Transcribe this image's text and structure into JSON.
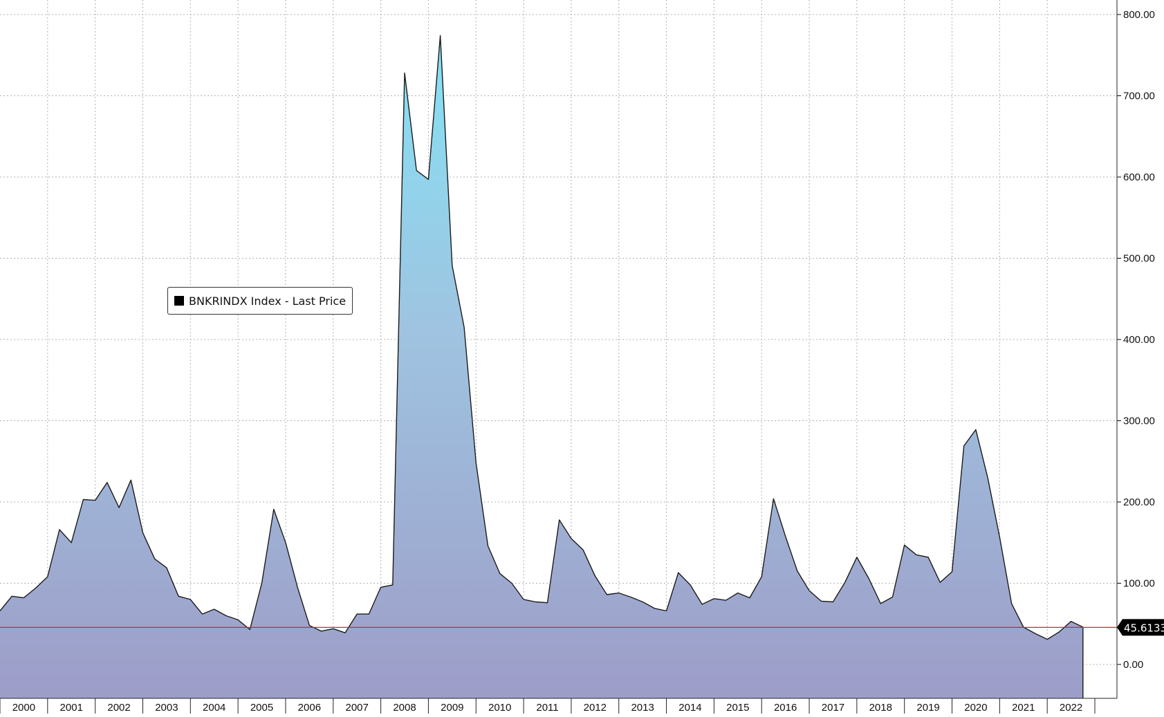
{
  "legend": {
    "label": "BNKRINDX Index - Last Price",
    "swatch_color": "#000000"
  },
  "last_value": {
    "label": "45.6133",
    "value": 45.6133,
    "line_color": "#e02020"
  },
  "colors": {
    "fill_top": "#84e3f5",
    "fill_bottom": "#9d9dc8",
    "line": "#1a1a1a",
    "grid": "#b0b0b0"
  },
  "chart_data": {
    "type": "area",
    "title": "",
    "xlabel": "",
    "ylabel": "",
    "ylim": [
      -40,
      800
    ],
    "xlim": [
      2000.0,
      2023.0
    ],
    "grid": true,
    "legend_position": "middle-left",
    "y_axis_side": "right",
    "y_ticks": [
      0,
      100,
      200,
      300,
      400,
      500,
      600,
      700,
      800
    ],
    "y_tick_labels": [
      "0.00",
      "100.00",
      "200.00",
      "300.00",
      "400.00",
      "500.00",
      "600.00",
      "700.00",
      "800.00"
    ],
    "x_tick_labels": [
      "2000",
      "2001",
      "2002",
      "2003",
      "2004",
      "2005",
      "2006",
      "2007",
      "2008",
      "2009",
      "2010",
      "2011",
      "2012",
      "2013",
      "2014",
      "2015",
      "2016",
      "2017",
      "2018",
      "2019",
      "2020",
      "2021",
      "2022"
    ],
    "series": [
      {
        "name": "BNKRINDX Index - Last Price",
        "x": [
          2000.0,
          2000.25,
          2000.5,
          2000.75,
          2001.0,
          2001.25,
          2001.5,
          2001.75,
          2002.0,
          2002.25,
          2002.5,
          2002.75,
          2003.0,
          2003.25,
          2003.5,
          2003.75,
          2004.0,
          2004.25,
          2004.5,
          2004.75,
          2005.0,
          2005.25,
          2005.5,
          2005.75,
          2006.0,
          2006.25,
          2006.5,
          2006.75,
          2007.0,
          2007.25,
          2007.5,
          2007.75,
          2008.0,
          2008.25,
          2008.5,
          2008.75,
          2009.0,
          2009.25,
          2009.5,
          2009.75,
          2010.0,
          2010.25,
          2010.5,
          2010.75,
          2011.0,
          2011.25,
          2011.5,
          2011.75,
          2012.0,
          2012.25,
          2012.5,
          2012.75,
          2013.0,
          2013.25,
          2013.5,
          2013.75,
          2014.0,
          2014.25,
          2014.5,
          2014.75,
          2015.0,
          2015.25,
          2015.5,
          2015.75,
          2016.0,
          2016.25,
          2016.5,
          2016.75,
          2017.0,
          2017.25,
          2017.5,
          2017.75,
          2018.0,
          2018.25,
          2018.5,
          2018.75,
          2019.0,
          2019.25,
          2019.5,
          2019.75,
          2020.0,
          2020.25,
          2020.5,
          2020.75,
          2021.0,
          2021.25,
          2021.5,
          2021.75,
          2022.0,
          2022.25,
          2022.5,
          2022.75
        ],
        "values": [
          66,
          84,
          82,
          94,
          108,
          166,
          150,
          203,
          202,
          224,
          193,
          227,
          162,
          130,
          119,
          84,
          80,
          62,
          68,
          60,
          55,
          43,
          100,
          191,
          150,
          95,
          48,
          41,
          44,
          39,
          62,
          62,
          95,
          98,
          728,
          608,
          597,
          774,
          491,
          415,
          248,
          146,
          112,
          100,
          80,
          77,
          76,
          178,
          155,
          141,
          109,
          86,
          88,
          83,
          77,
          69,
          66,
          113,
          98,
          74,
          81,
          79,
          88,
          82,
          108,
          204,
          158,
          115,
          91,
          78,
          77,
          101,
          132,
          106,
          75,
          83,
          147,
          135,
          132,
          101,
          114,
          269,
          289,
          230,
          157,
          75,
          46,
          38,
          31,
          40,
          53,
          46
        ]
      }
    ]
  }
}
